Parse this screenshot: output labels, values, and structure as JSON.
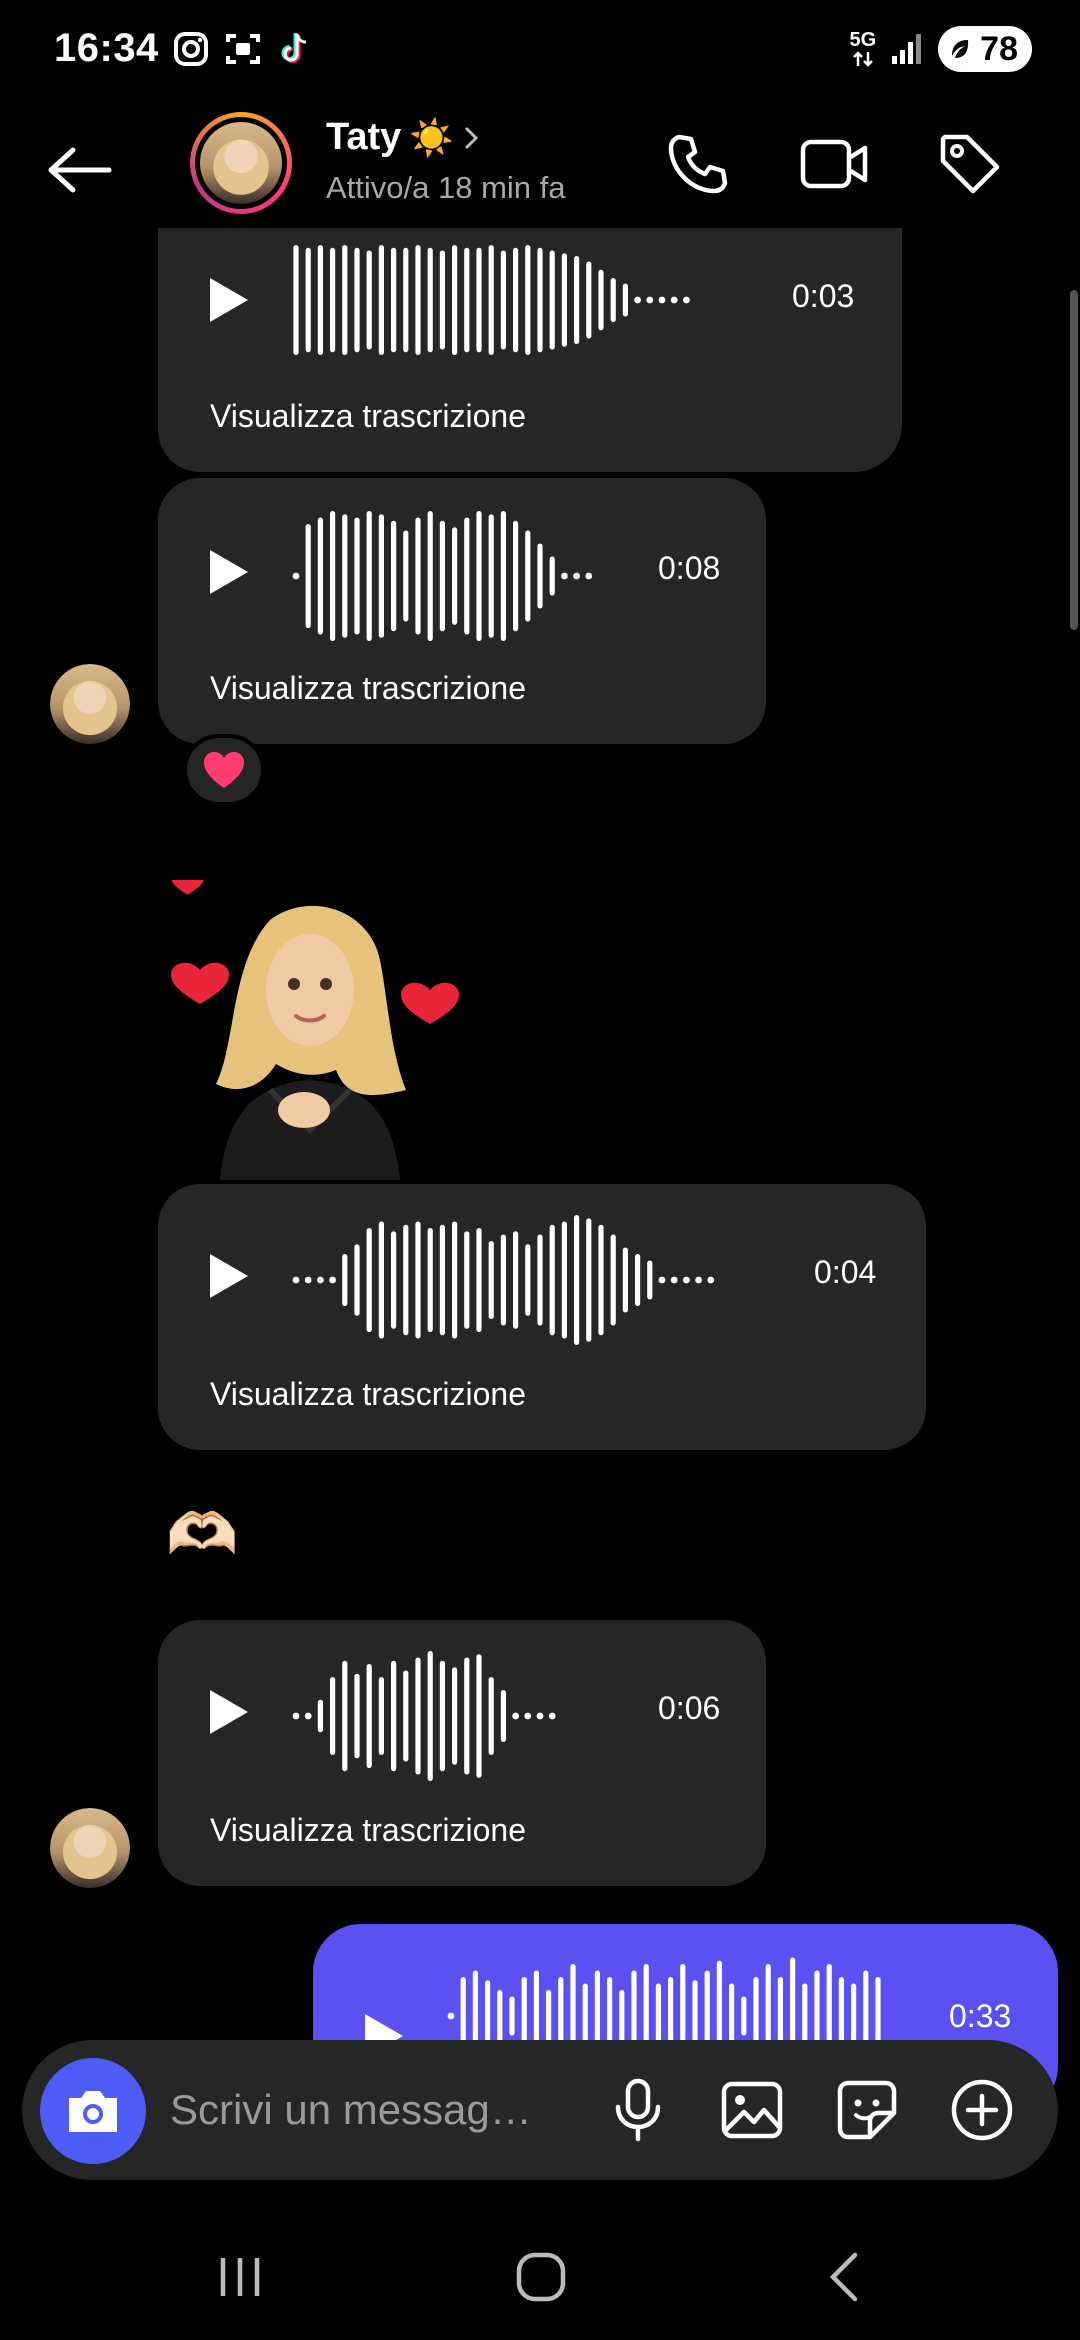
{
  "status_bar": {
    "time": "16:34",
    "network": "5G",
    "battery": "78"
  },
  "header": {
    "name": "Taty",
    "name_emoji": "☀️",
    "status": "Attivo/a 18 min fa",
    "icons": [
      "back-arrow-icon",
      "phone-icon",
      "video-icon",
      "tag-icon"
    ]
  },
  "messages": [
    {
      "duration": "0:03",
      "transcript_label": "Visualizza trascrizione"
    },
    {
      "duration": "0:08",
      "transcript_label": "Visualizza trascrizione",
      "reaction": "❤️"
    },
    {
      "duration": "0:04",
      "transcript_label": "Visualizza trascrizione"
    },
    {
      "emoji": "🫶🏻"
    },
    {
      "duration": "0:06",
      "transcript_label": "Visualizza trascrizione"
    },
    {
      "duration": "0:33",
      "sent": true
    }
  ],
  "composer": {
    "placeholder": "Scrivi un messag…",
    "icons": [
      "camera-icon",
      "microphone-icon",
      "gallery-icon",
      "sticker-icon",
      "plus-icon"
    ]
  },
  "colors": {
    "bubble": "#262626",
    "sent_bubble": "#5b51f0",
    "camera_button": "#4c5cf5",
    "background": "#000000"
  }
}
